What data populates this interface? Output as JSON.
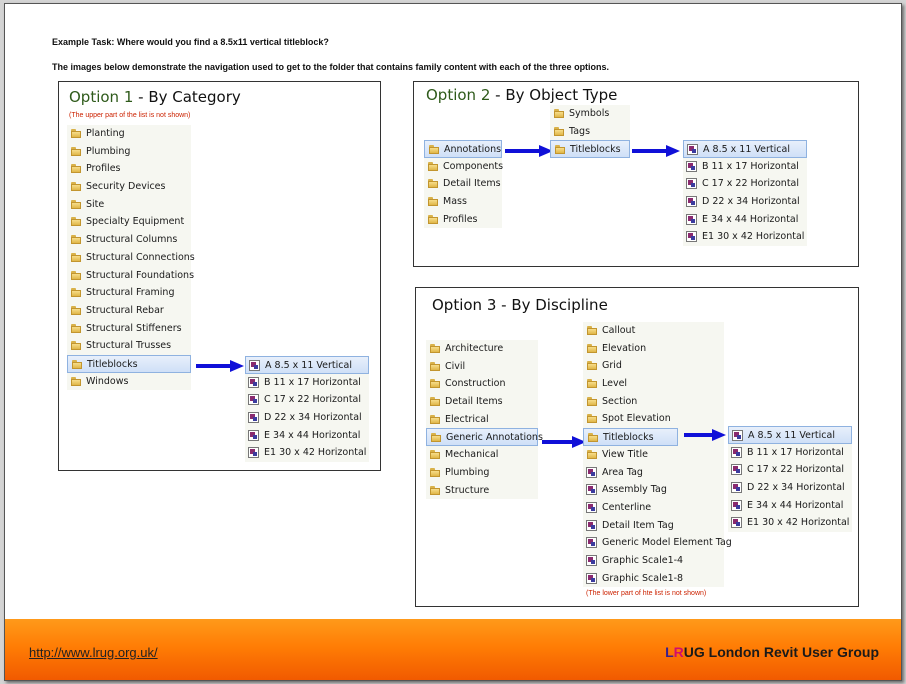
{
  "task": {
    "question": "Example Task: Where would you find a 8.5x11 vertical titleblock?",
    "description": "The images below demonstrate the navigation used to get to the folder that contains family content with each of the three options."
  },
  "option1": {
    "title_num": "Option 1",
    "title_rest": " - By Category",
    "note": "(The upper part of the list is not shown)",
    "categories": [
      "Planting",
      "Plumbing",
      "Profiles",
      "Security Devices",
      "Site",
      "Specialty Equipment",
      "Structural Columns",
      "Structural Connections",
      "Structural Foundations",
      "Structural Framing",
      "Structural Rebar",
      "Structural Stiffeners",
      "Structural Trusses",
      "Titleblocks",
      "Windows"
    ],
    "titleblocks": [
      "A 8.5 x 11 Vertical",
      "B 11 x 17 Horizontal",
      "C 17 x 22 Horizontal",
      "D 22 x 34 Horizontal",
      "E 34 x 44 Horizontal",
      "E1 30 x 42 Horizontal"
    ]
  },
  "option2": {
    "title_num": "Option 2",
    "title_rest": " - By Object Type",
    "types": [
      "Annotations",
      "Components",
      "Detail Items",
      "Mass",
      "Profiles"
    ],
    "subtypes": [
      "Symbols",
      "Tags",
      "Titleblocks"
    ],
    "titleblocks": [
      "A 8.5 x 11 Vertical",
      "B 11 x 17 Horizontal",
      "C 17 x 22 Horizontal",
      "D 22 x 34 Horizontal",
      "E 34 x 44 Horizontal",
      "E1 30 x 42 Horizontal"
    ]
  },
  "option3": {
    "title": "Option 3 - By Discipline",
    "disciplines": [
      "Architecture",
      "Civil",
      "Construction",
      "Detail Items",
      "Electrical",
      "Generic Annotations",
      "Mechanical",
      "Plumbing",
      "Structure"
    ],
    "annotation_folders": [
      "Callout",
      "Elevation",
      "Grid",
      "Level",
      "Section",
      "Spot Elevation",
      "Titleblocks",
      "View Title"
    ],
    "annotation_families": [
      "Area Tag",
      "Assembly Tag",
      "Centerline",
      "Detail Item Tag",
      "Generic Model Element Tag",
      "Graphic Scale1-4",
      "Graphic Scale1-8"
    ],
    "note": "(The  lower part of hte list is not shown)",
    "titleblocks": [
      "A 8.5 x 11 Vertical",
      "B 11 x 17 Horizontal",
      "C 17 x 22 Horizontal",
      "D 22 x 34 Horizontal",
      "E 34 x 44 Horizontal",
      "E1 30 x 42 Horizontal"
    ]
  },
  "footer": {
    "url": "http://www.lrug.org.uk/",
    "brand_l": "L",
    "brand_r": "R",
    "brand_rest": "UG London Revit User Group"
  },
  "colors": {
    "arrow": "#1010d8",
    "footer": "#ff7d05",
    "selection": "#cfe0f7"
  }
}
